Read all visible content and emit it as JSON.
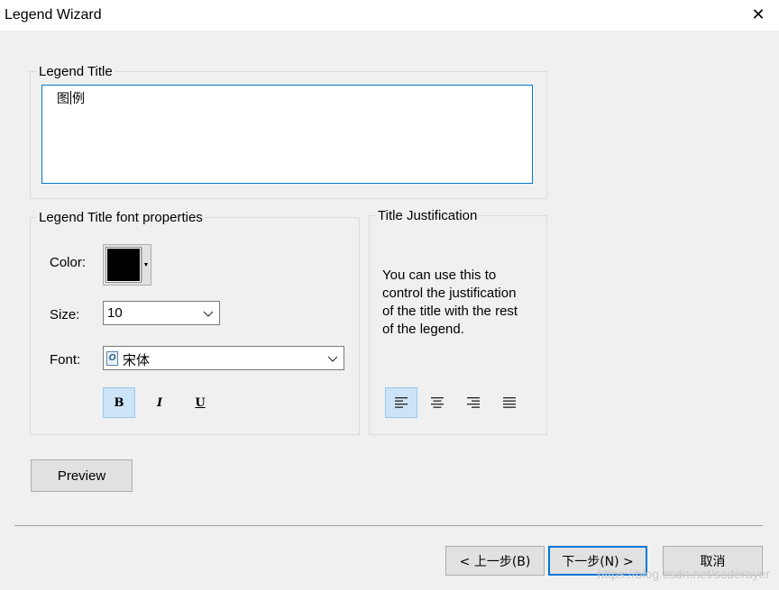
{
  "window": {
    "title": "Legend Wizard",
    "close_glyph": "✕"
  },
  "legend_title_group": {
    "label": "Legend Title",
    "value_before_caret": "图",
    "value_after_caret": "例"
  },
  "font_group": {
    "label": "Legend Title font properties",
    "color_label": "Color:",
    "color_value": "#000000",
    "size_label": "Size:",
    "size_value": "10",
    "font_label": "Font:",
    "font_icon": "opentype-font-icon",
    "font_value": "宋体",
    "bold_glyph": "B",
    "italic_glyph": "I",
    "underline_glyph": "U",
    "bold_active": true
  },
  "justification_group": {
    "label": "Title Justification",
    "description": "You can use this to control the justification of the title with the rest of the legend.",
    "options": [
      "align-left-icon",
      "align-center-icon",
      "align-right-icon",
      "align-justify-icon"
    ],
    "selected": "align-left-icon"
  },
  "preview_button": "Preview",
  "footer": {
    "back_label": "< 上一步(B)",
    "next_label": "下一步(N) >",
    "cancel_label": "取消"
  },
  "watermark": "https://blog.csdn.net/soderayer"
}
